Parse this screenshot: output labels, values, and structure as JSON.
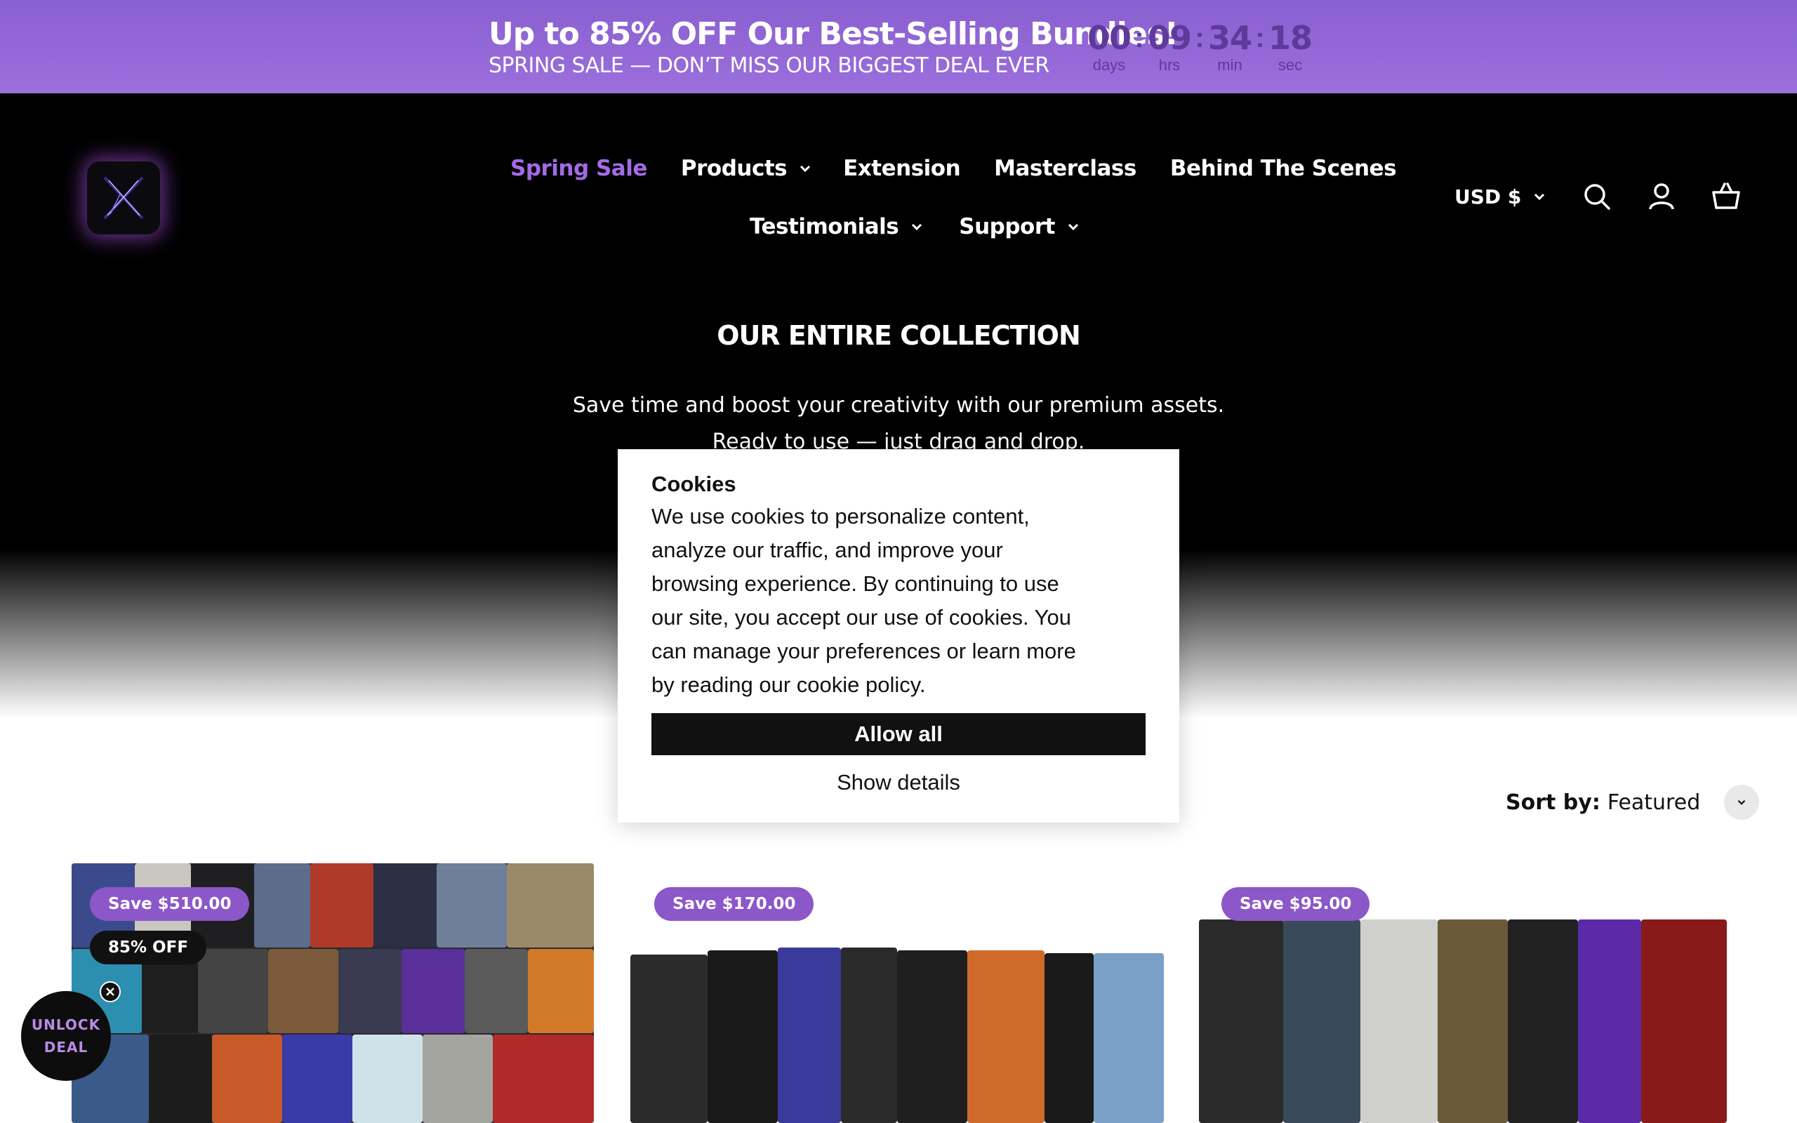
{
  "announcement": {
    "title": "Up to 85% OFF Our Best-Selling Bundles!",
    "subtitle": "SPRING SALE — DON’T MISS OUR BIGGEST DEAL EVER",
    "countdown": {
      "days": "00",
      "hrs": "09",
      "min": "34",
      "sec": "18",
      "days_label": "days",
      "hrs_label": "hrs",
      "min_label": "min",
      "sec_label": "sec",
      "separator": ":"
    }
  },
  "nav": {
    "spring_sale": "Spring Sale",
    "products": "Products",
    "extension": "Extension",
    "masterclass": "Masterclass",
    "behind_the_scenes": "Behind The Scenes",
    "testimonials": "Testimonials",
    "support": "Support"
  },
  "header": {
    "currency": "USD $",
    "icons": [
      "search-icon",
      "account-icon",
      "cart-icon"
    ]
  },
  "collection": {
    "title": "OUR ENTIRE COLLECTION",
    "desc_line1": "Save time and boost your creativity with our premium assets.",
    "desc_line2": "Ready to use — just drag and drop."
  },
  "sort": {
    "label": "Sort by:",
    "value": "Featured"
  },
  "products": [
    {
      "save_badge": "Save  $510.00",
      "off_badge": "85% OFF"
    },
    {
      "save_badge": "Save  $170.00"
    },
    {
      "save_badge": "Save  $95.00"
    }
  ],
  "cookie": {
    "title": "Cookies",
    "body": "We use cookies to personalize content, analyze our traffic, and improve your browsing experience. By continuing to use our site, you accept our use of cookies. You can manage your preferences or learn more by reading our cookie policy.",
    "allow": "Allow all",
    "details": "Show details"
  },
  "unlock": {
    "line1": "UNLOCK",
    "line2": "DEAL"
  },
  "colors": {
    "accent": "#a36be6",
    "announcement_bg": "#9b6fdc",
    "badge": "#8c57c9"
  }
}
